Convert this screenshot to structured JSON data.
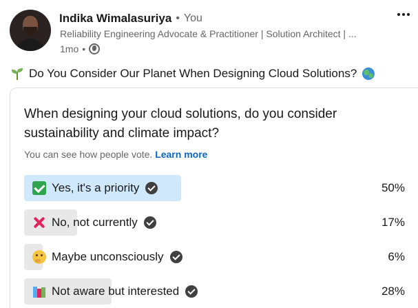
{
  "author": {
    "name": "Indika Wimalasuriya",
    "separator": "•",
    "relation": "You",
    "headline": "Reliability Engineering Advocate & Practitioner | Solution Architect | ...",
    "time": "1mo",
    "dot": "•",
    "visibility_icon": "globe-icon"
  },
  "post": {
    "title": "Do You Consider Our Planet When Designing Cloud Solutions?",
    "leading_icon": "sprout-icon",
    "trailing_icon": "earth-icon"
  },
  "poll": {
    "question": "When designing your cloud solutions, do you consider sustainability and climate impact?",
    "note": "You can see how people vote.",
    "learn_more": "Learn more",
    "options": [
      {
        "label": "Yes, it's a priority",
        "percent": "50%",
        "share": 0.5,
        "selected": true,
        "icon": "check-mark-emoji"
      },
      {
        "label": "No, not currently",
        "percent": "17%",
        "share": 0.17,
        "selected": false,
        "icon": "cross-mark-emoji"
      },
      {
        "label": "Maybe unconsciously",
        "percent": "6%",
        "share": 0.06,
        "selected": false,
        "icon": "thinking-face-emoji"
      },
      {
        "label": "Not aware but interested",
        "percent": "28%",
        "share": 0.28,
        "selected": false,
        "icon": "books-emoji"
      }
    ],
    "colors": {
      "selected_fill": "#d0e8fb",
      "fill": "#e8e8e8",
      "link": "#0a66c2"
    }
  }
}
